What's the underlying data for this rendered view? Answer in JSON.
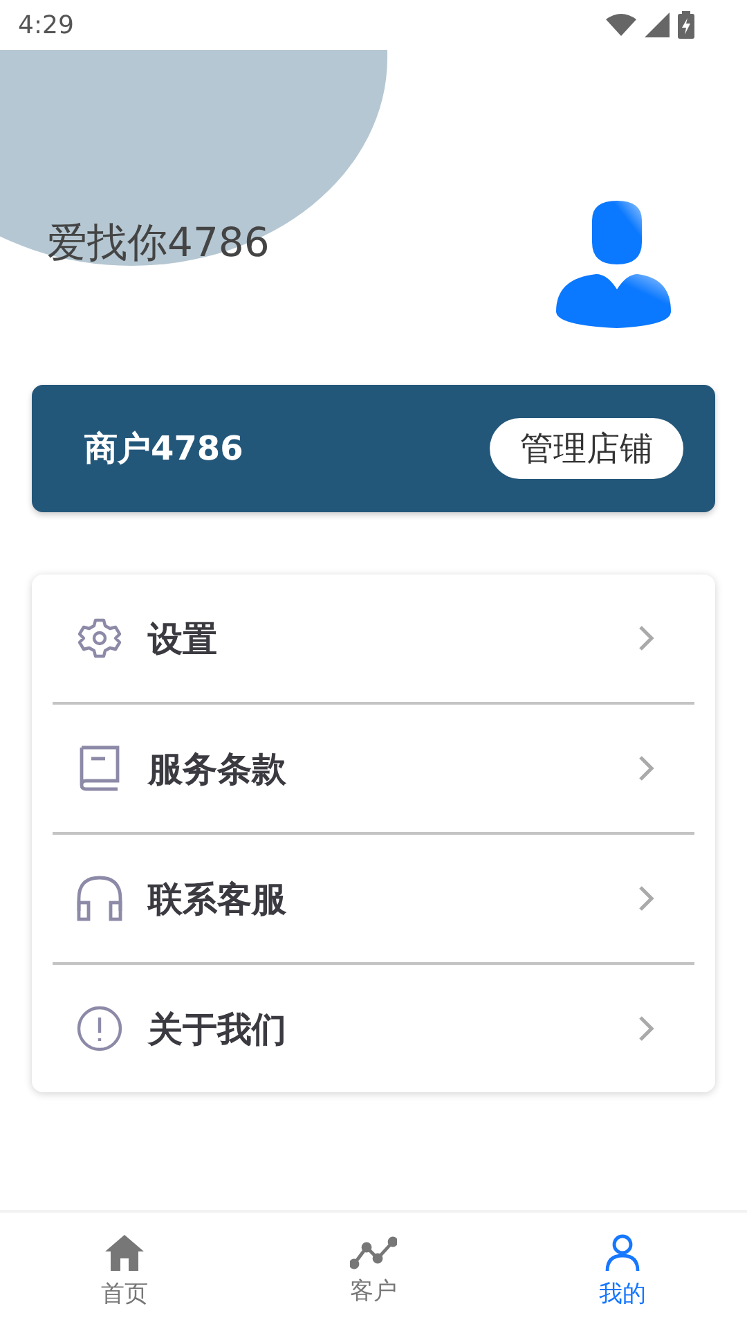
{
  "status_bar": {
    "time": "4:29"
  },
  "profile": {
    "name": "爱找你4786"
  },
  "merchant": {
    "name": "商户4786",
    "button": "管理店铺"
  },
  "menu": [
    {
      "kind": "settings",
      "label": "设置"
    },
    {
      "kind": "terms",
      "label": "服务条款"
    },
    {
      "kind": "support",
      "label": "联系客服"
    },
    {
      "kind": "about",
      "label": "关于我们"
    }
  ],
  "tabs": [
    {
      "kind": "home",
      "label": "首页",
      "selected": false
    },
    {
      "kind": "customers",
      "label": "客户",
      "selected": false
    },
    {
      "kind": "me",
      "label": "我的",
      "selected": true
    }
  ]
}
